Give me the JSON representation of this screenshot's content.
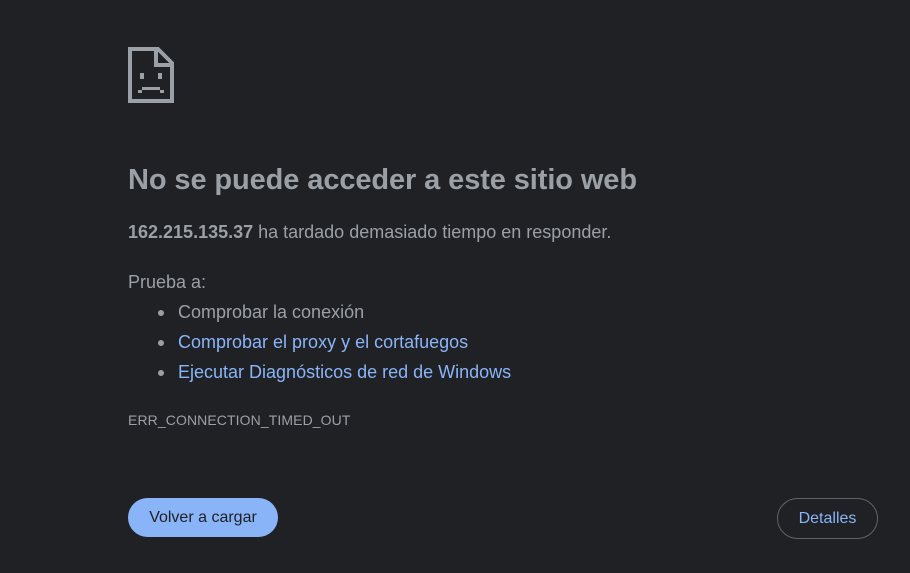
{
  "error_page": {
    "icon": "sad-document-icon",
    "title": "No se puede acceder a este sitio web",
    "host": "162.215.135.37",
    "summary_rest": " ha tardado demasiado tiempo en responder.",
    "try_label": "Prueba a:",
    "suggestions": [
      {
        "text": "Comprobar la conexión",
        "is_link": false
      },
      {
        "text": "Comprobar el proxy y el cortafuegos",
        "is_link": true
      },
      {
        "text": "Ejecutar Diagnósticos de red de Windows",
        "is_link": true
      }
    ],
    "error_code": "ERR_CONNECTION_TIMED_OUT",
    "reload_label": "Volver a cargar",
    "details_label": "Detalles"
  },
  "colors": {
    "background": "#202124",
    "text": "#9aa0a6",
    "link": "#8ab4f8",
    "primary_button": "#8ab4f8",
    "button_border": "#5f6368"
  }
}
